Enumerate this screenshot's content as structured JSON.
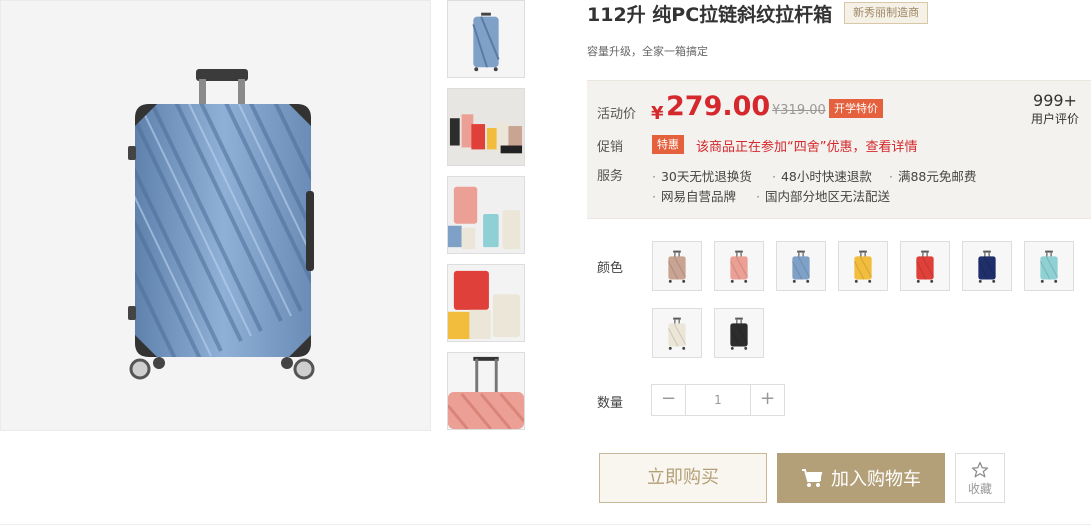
{
  "product": {
    "title": "112升 纯PC拉链斜纹拉杆箱",
    "maker_tag": "新秀丽制造商",
    "subtitle": "容量升级，全家一箱搞定"
  },
  "price": {
    "label": "活动价",
    "currency": "¥",
    "current": "279.00",
    "original": "¥319.00",
    "badge": "开学特价"
  },
  "reviews": {
    "count": "999+",
    "label": "用户评价"
  },
  "promotion": {
    "label": "促销",
    "badge": "特惠",
    "text": "该商品正在参加“四舍”优惠，查看详情"
  },
  "services": {
    "label": "服务",
    "items": [
      "30天无忧退换货",
      "48小时快速退款",
      "满88元免邮费",
      "网易自营品牌",
      "国内部分地区无法配送"
    ]
  },
  "colors": {
    "label": "颜色",
    "swatches": [
      {
        "name": "rose-gold",
        "color": "#c9a493"
      },
      {
        "name": "pink",
        "color": "#ec9f95"
      },
      {
        "name": "blue",
        "color": "#7fa1c8"
      },
      {
        "name": "yellow",
        "color": "#f2bd3c"
      },
      {
        "name": "red",
        "color": "#e0403a"
      },
      {
        "name": "navy",
        "color": "#1f2f6a"
      },
      {
        "name": "mint",
        "color": "#8fd0d4"
      },
      {
        "name": "cream",
        "color": "#ece6d8"
      },
      {
        "name": "black",
        "color": "#2d2d2d"
      }
    ]
  },
  "quantity": {
    "label": "数量",
    "minus": "−",
    "value": "1",
    "plus": "+"
  },
  "actions": {
    "buy_now": "立即购买",
    "add_to_cart": "加入购物车",
    "favorite": "收藏"
  },
  "colors_theme": {
    "accent": "#b4a078",
    "price_red": "#d4282d",
    "badge_orange": "#e5613d",
    "main_suitcase": "#7fa1c8"
  }
}
